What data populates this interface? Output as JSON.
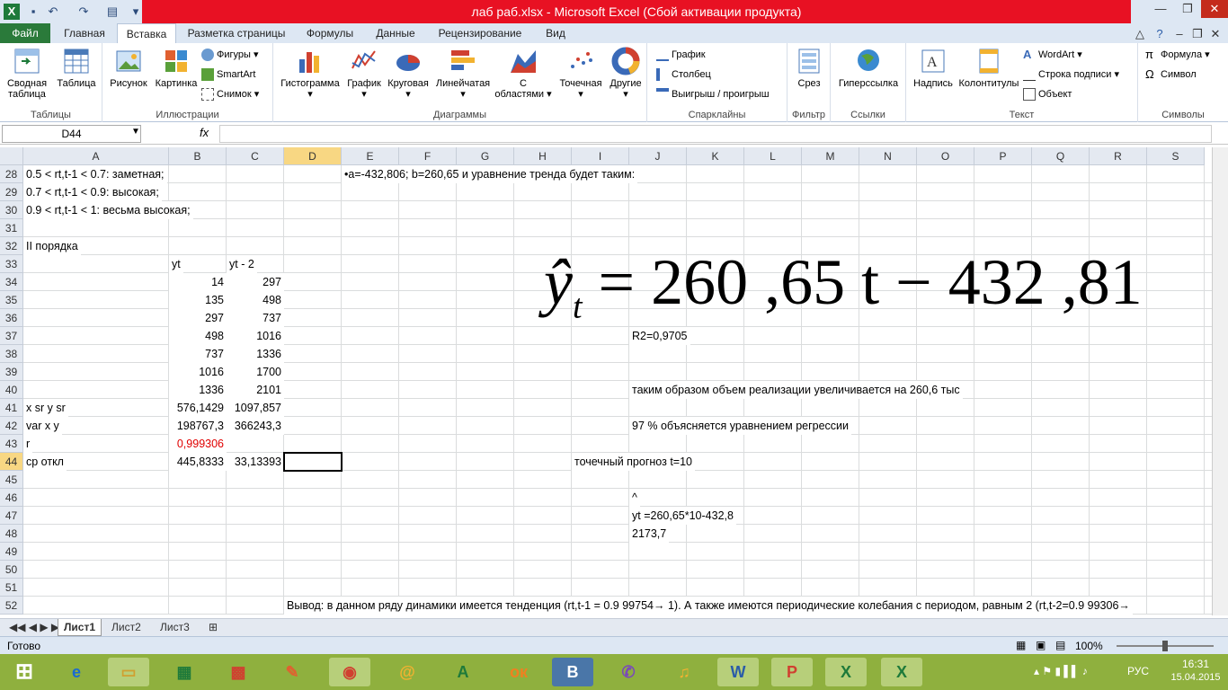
{
  "window": {
    "title": "лаб  раб.xlsx  -  Microsoft Excel (Сбой активации продукта)"
  },
  "tabs": [
    "Файл",
    "Главная",
    "Вставка",
    "Разметка страницы",
    "Формулы",
    "Данные",
    "Рецензирование",
    "Вид"
  ],
  "ribbon": {
    "groups": {
      "tables": "Таблицы",
      "illustrations": "Иллюстрации",
      "charts": "Диаграммы",
      "sparklines": "Спарклайны",
      "filter": "Фильтр",
      "links": "Ссылки",
      "text": "Текст",
      "symbols": "Символы"
    },
    "buttons": {
      "pivot": "Сводная таблица",
      "table": "Таблица",
      "picture": "Рисунок",
      "clipart": "Картинка",
      "shapes": "Фигуры",
      "smartart": "SmartArt",
      "screenshot": "Снимок",
      "histogram": "Гистограмма",
      "graph": "График",
      "pie": "Круговая",
      "linear": "Линейчатая",
      "area": "С областями",
      "scatter": "Точечная",
      "other": "Другие",
      "spark_line": "График",
      "spark_col": "Столбец",
      "spark_win": "Выигрыш / проигрыш",
      "slicer": "Срез",
      "hyperlink": "Гиперссылка",
      "textbox": "Надпись",
      "headers": "Колонтитулы",
      "wordart": "WordArt",
      "sigline": "Строка подписи",
      "object": "Объект",
      "equation": "Формула",
      "symbol": "Символ"
    }
  },
  "formula_bar": {
    "name_box": "D44",
    "fx": "fx",
    "value": ""
  },
  "columns": [
    "A",
    "B",
    "C",
    "D",
    "E",
    "F",
    "G",
    "H",
    "I",
    "J",
    "K",
    "L",
    "M",
    "N",
    "O",
    "P",
    "Q",
    "R",
    "S"
  ],
  "rows": [
    "28",
    "29",
    "30",
    "31",
    "32",
    "33",
    "34",
    "35",
    "36",
    "37",
    "38",
    "39",
    "40",
    "41",
    "42",
    "43",
    "44",
    "45",
    "46",
    "47",
    "48",
    "49",
    "50",
    "51",
    "52"
  ],
  "cells": {
    "A28": "0.5 < rt,t-1 < 0.7: заметная;",
    "A29": "0.7 < rt,t-1 < 0.9: высокая;",
    "A30": "0.9 < rt,t-1 < 1: весьма высокая;",
    "A32": "II порядка",
    "B33": "yt",
    "C33": "yt - 2",
    "B34": "14",
    "C34": "297",
    "B35": "135",
    "C35": "498",
    "B36": "297",
    "C36": "737",
    "B37": "498",
    "C37": "1016",
    "B38": "737",
    "C38": "1336",
    "B39": "1016",
    "C39": "1700",
    "B40": "1336",
    "C40": "2101",
    "A41": "x sr       y sr",
    "B41": "576,1429",
    "C41": "1097,857",
    "A42": "var x      y",
    "B42": "198767,3",
    "C42": "366243,3",
    "A43": "r",
    "B43": "0,999306",
    "A44": "ср откл",
    "B44": "445,8333",
    "C44": "33,13393",
    "E28": "•a=-432,806; b=260,65 и уравнение тренда будет таким:",
    "J37": "R2=0,9705",
    "J40": "таким образом объем реализации  увеличивается на 260,6 тыс",
    "J42": "97 % объясняется уравнением регрессии",
    "I44": "точечный прогноз    t=10",
    "J46": "^",
    "J47": "yt =260,65*10-432,8",
    "J48": "      2173,7",
    "D52": "Вывод: в данном ряду динамики имеется тенденция (rt,t-1 = 0.9 99754→ 1). А также имеются периодические колебания с периодом, равным 2 (rt,t-2=0.9 99306→"
  },
  "equation": {
    "lhs": "ŷ",
    "sub": "t",
    "rhs": " =  260  ,65 t  −  432  ,81"
  },
  "sheets": [
    "Лист1",
    "Лист2",
    "Лист3"
  ],
  "status": {
    "ready": "Готово",
    "zoom": "100%"
  },
  "clock": {
    "time": "16:31",
    "date": "15.04.2015",
    "lang": "РУС"
  },
  "colors": {
    "title_red": "#e81123",
    "file_green": "#2a7a3a",
    "taskbar": "#8fb03e",
    "red_value": "#e00000"
  }
}
